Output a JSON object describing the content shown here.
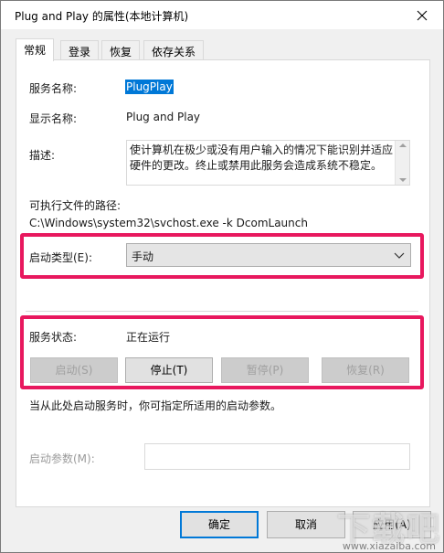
{
  "window": {
    "title": "Plug and Play 的属性(本地计算机)"
  },
  "tabs": [
    {
      "label": "常规",
      "active": true
    },
    {
      "label": "登录",
      "active": false
    },
    {
      "label": "恢复",
      "active": false
    },
    {
      "label": "依存关系",
      "active": false
    }
  ],
  "general": {
    "service_name_label": "服务名称:",
    "service_name_value": "PlugPlay",
    "display_name_label": "显示名称:",
    "display_name_value": "Plug and Play",
    "description_label": "描述:",
    "description_text": "使计算机在极少或没有用户输入的情况下能识别并适应硬件的更改。终止或禁用此服务会造成系统不稳定。",
    "exe_path_label": "可执行文件的路径:",
    "exe_path_value": "C:\\Windows\\system32\\svchost.exe -k DcomLaunch",
    "startup_type_label": "启动类型(E):",
    "startup_type_value": "手动",
    "service_status_label": "服务状态:",
    "service_status_value": "正在运行",
    "start_button": "启动(S)",
    "stop_button": "停止(T)",
    "pause_button": "暂停(P)",
    "resume_button": "恢复(R)",
    "hint_text": "当从此处启动服务时，你可指定所适用的启动参数。",
    "start_params_label": "启动参数(M):",
    "start_params_value": ""
  },
  "footer": {
    "ok_button": "确定",
    "cancel_button": "取消",
    "apply_button": "应用(A)"
  },
  "watermark": {
    "text": "下载吧",
    "url": "www.xiazaiba.com"
  },
  "colors": {
    "highlight_box": "#e8185e",
    "accent": "#0078d7"
  }
}
